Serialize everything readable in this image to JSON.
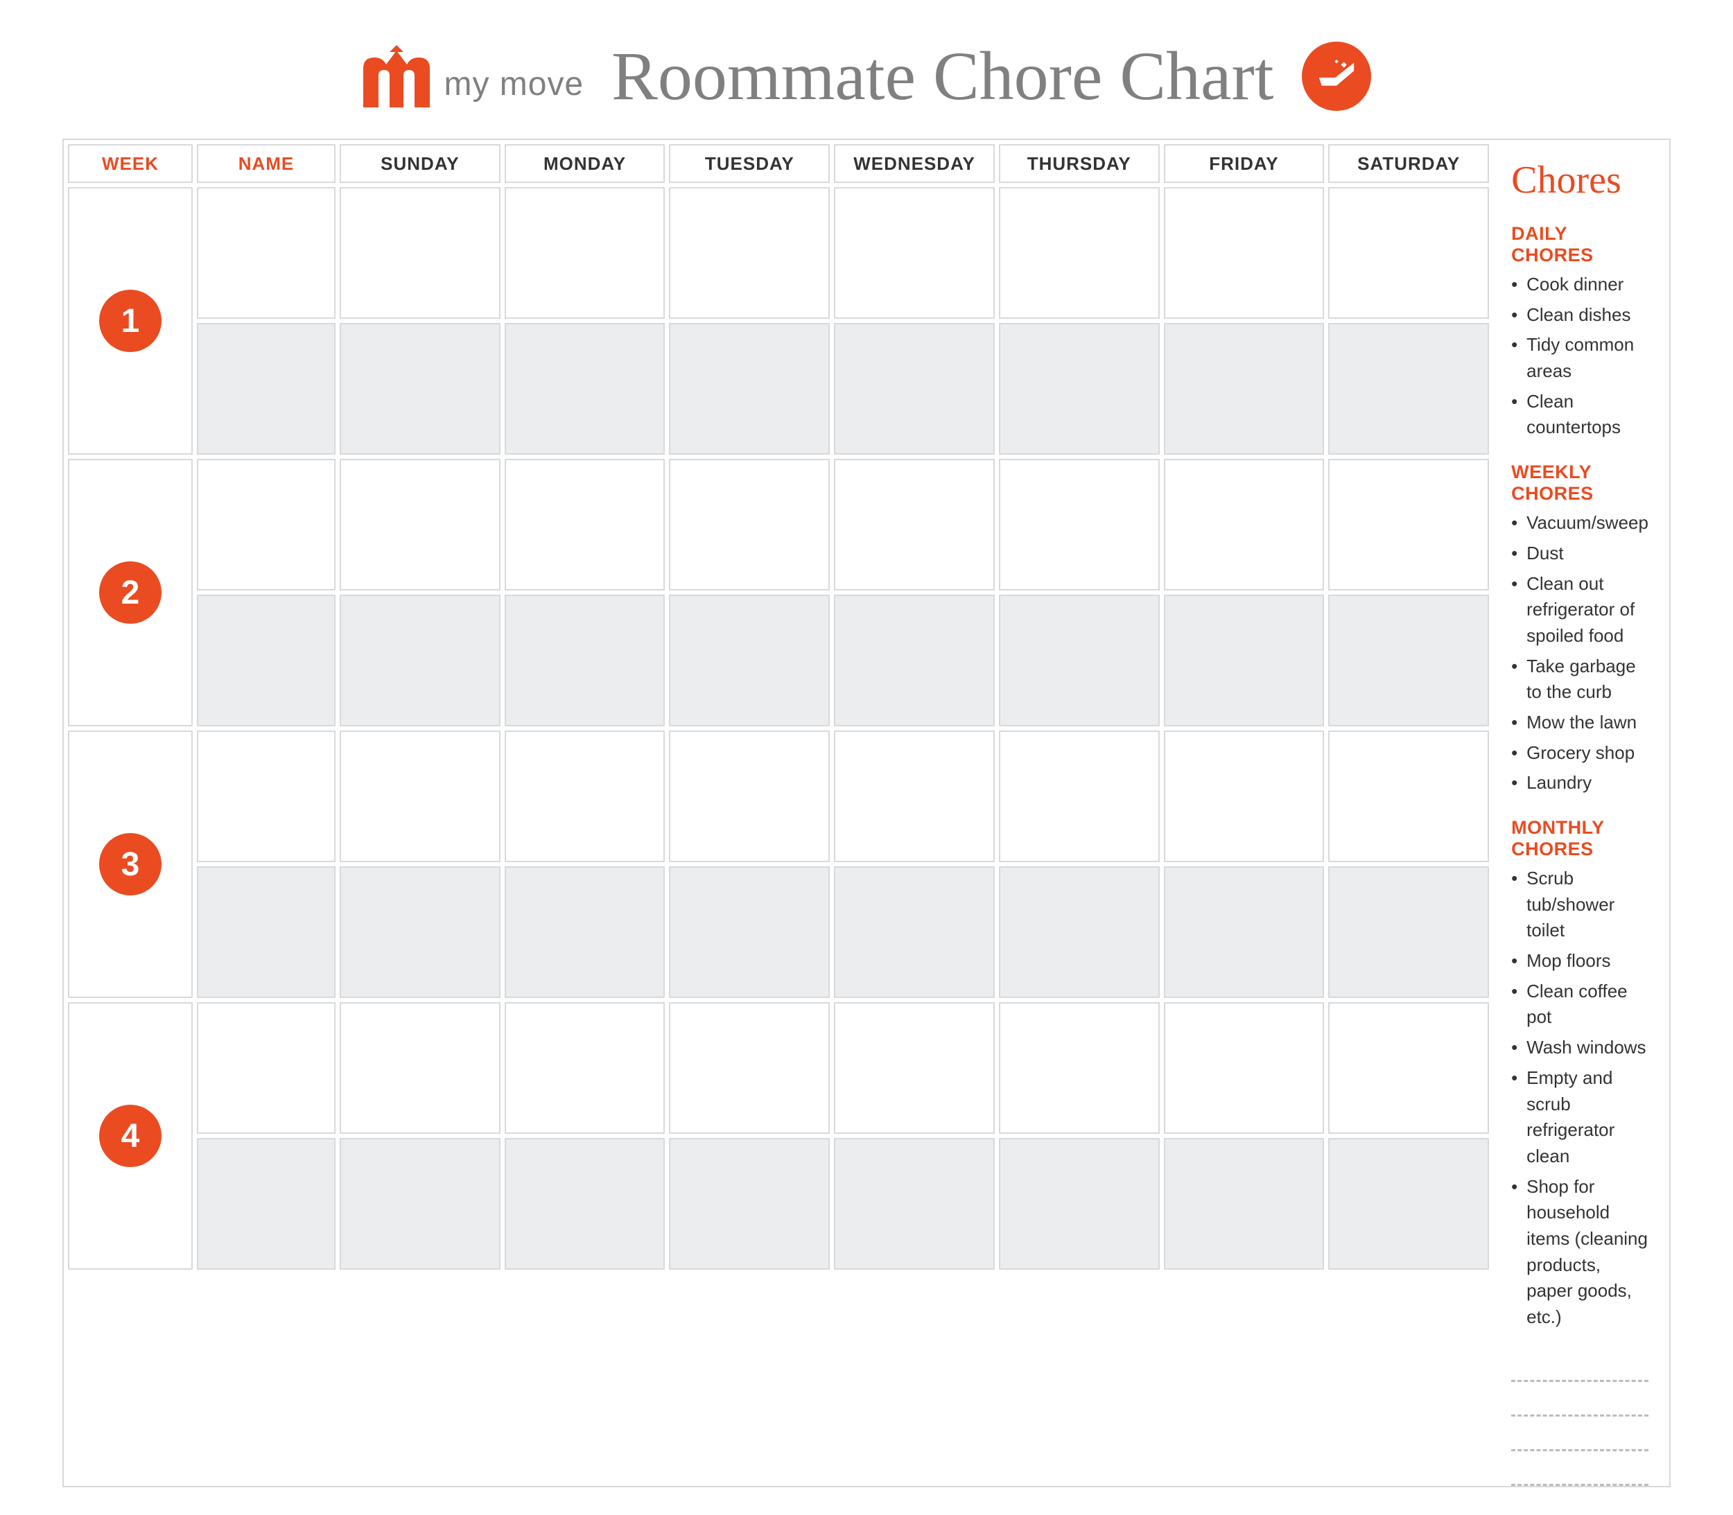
{
  "brand": {
    "name": "my move"
  },
  "title": "Roommate Chore Chart",
  "columns": {
    "week": "WEEK",
    "name": "NAME",
    "days": [
      "SUNDAY",
      "MONDAY",
      "TUESDAY",
      "WEDNESDAY",
      "THURSDAY",
      "FRIDAY",
      "SATURDAY"
    ]
  },
  "weeks": [
    "1",
    "2",
    "3",
    "4"
  ],
  "sidebar": {
    "title": "Chores",
    "sections": [
      {
        "heading": "DAILY CHORES",
        "items": [
          "Cook dinner",
          "Clean dishes",
          "Tidy common areas",
          "Clean countertops"
        ]
      },
      {
        "heading": "WEEKLY CHORES",
        "items": [
          "Vacuum/sweep",
          "Dust",
          "Clean out refrigerator of spoiled food",
          "Take garbage to the curb",
          "Mow the lawn",
          "Grocery shop",
          "Laundry"
        ]
      },
      {
        "heading": "MONTHLY CHORES",
        "items": [
          "Scrub tub/shower toilet",
          "Mop floors",
          "Clean coffee pot",
          "Wash windows",
          "Empty and scrub refrigerator clean",
          "Shop for household items (cleaning products, paper goods, etc.)"
        ]
      }
    ]
  },
  "colors": {
    "accent": "#ea4b21",
    "muted": "#808080",
    "line": "#d7d9db",
    "shade": "#ebedee"
  }
}
